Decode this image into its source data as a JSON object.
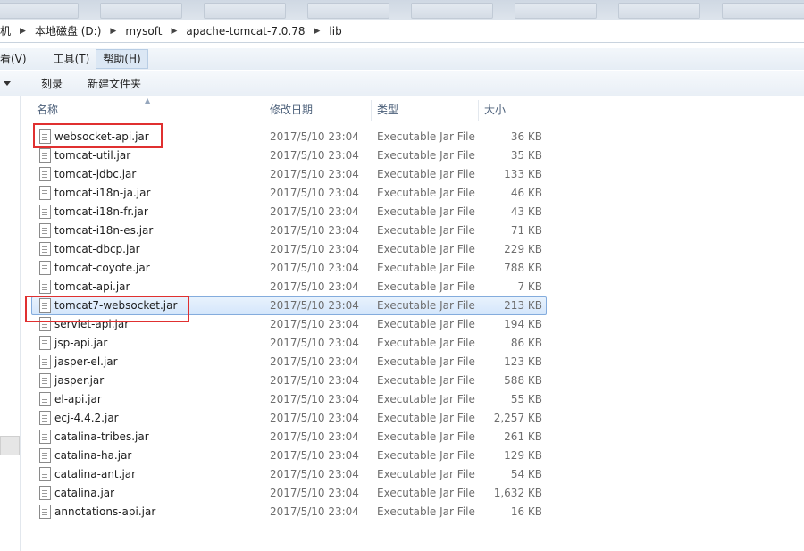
{
  "breadcrumbs": [
    "机",
    "本地磁盘 (D:)",
    "mysoft",
    "apache-tomcat-7.0.78",
    "lib"
  ],
  "menu": [
    "看(V)",
    "工具(T)",
    "帮助(H)"
  ],
  "toolbar": {
    "burn": "刻录",
    "new_folder": "新建文件夹"
  },
  "columns": {
    "name": "名称",
    "date": "修改日期",
    "type": "类型",
    "size": "大小"
  },
  "files": [
    {
      "name": "websocket-api.jar",
      "date": "2017/5/10 23:04",
      "type": "Executable Jar File",
      "size": "36 KB"
    },
    {
      "name": "tomcat-util.jar",
      "date": "2017/5/10 23:04",
      "type": "Executable Jar File",
      "size": "35 KB"
    },
    {
      "name": "tomcat-jdbc.jar",
      "date": "2017/5/10 23:04",
      "type": "Executable Jar File",
      "size": "133 KB"
    },
    {
      "name": "tomcat-i18n-ja.jar",
      "date": "2017/5/10 23:04",
      "type": "Executable Jar File",
      "size": "46 KB"
    },
    {
      "name": "tomcat-i18n-fr.jar",
      "date": "2017/5/10 23:04",
      "type": "Executable Jar File",
      "size": "43 KB"
    },
    {
      "name": "tomcat-i18n-es.jar",
      "date": "2017/5/10 23:04",
      "type": "Executable Jar File",
      "size": "71 KB"
    },
    {
      "name": "tomcat-dbcp.jar",
      "date": "2017/5/10 23:04",
      "type": "Executable Jar File",
      "size": "229 KB"
    },
    {
      "name": "tomcat-coyote.jar",
      "date": "2017/5/10 23:04",
      "type": "Executable Jar File",
      "size": "788 KB"
    },
    {
      "name": "tomcat-api.jar",
      "date": "2017/5/10 23:04",
      "type": "Executable Jar File",
      "size": "7 KB"
    },
    {
      "name": "tomcat7-websocket.jar",
      "date": "2017/5/10 23:04",
      "type": "Executable Jar File",
      "size": "213 KB",
      "selected": true
    },
    {
      "name": "servlet-api.jar",
      "date": "2017/5/10 23:04",
      "type": "Executable Jar File",
      "size": "194 KB"
    },
    {
      "name": "jsp-api.jar",
      "date": "2017/5/10 23:04",
      "type": "Executable Jar File",
      "size": "86 KB"
    },
    {
      "name": "jasper-el.jar",
      "date": "2017/5/10 23:04",
      "type": "Executable Jar File",
      "size": "123 KB"
    },
    {
      "name": "jasper.jar",
      "date": "2017/5/10 23:04",
      "type": "Executable Jar File",
      "size": "588 KB"
    },
    {
      "name": "el-api.jar",
      "date": "2017/5/10 23:04",
      "type": "Executable Jar File",
      "size": "55 KB"
    },
    {
      "name": "ecj-4.4.2.jar",
      "date": "2017/5/10 23:04",
      "type": "Executable Jar File",
      "size": "2,257 KB"
    },
    {
      "name": "catalina-tribes.jar",
      "date": "2017/5/10 23:04",
      "type": "Executable Jar File",
      "size": "261 KB"
    },
    {
      "name": "catalina-ha.jar",
      "date": "2017/5/10 23:04",
      "type": "Executable Jar File",
      "size": "129 KB"
    },
    {
      "name": "catalina-ant.jar",
      "date": "2017/5/10 23:04",
      "type": "Executable Jar File",
      "size": "54 KB"
    },
    {
      "name": "catalina.jar",
      "date": "2017/5/10 23:04",
      "type": "Executable Jar File",
      "size": "1,632 KB"
    },
    {
      "name": "annotations-api.jar",
      "date": "2017/5/10 23:04",
      "type": "Executable Jar File",
      "size": "16 KB"
    }
  ],
  "highlight_color": "#e03030"
}
